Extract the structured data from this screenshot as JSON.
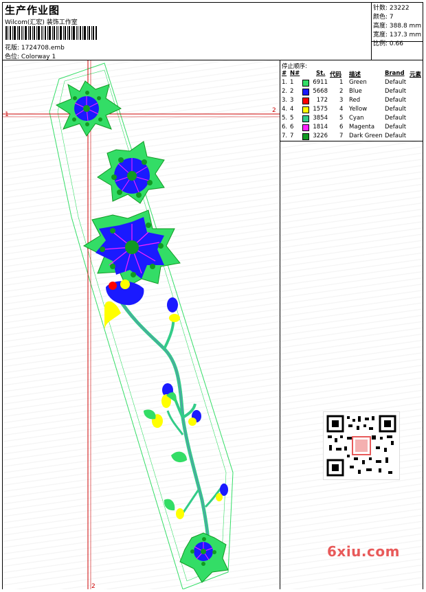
{
  "header": {
    "title": "生产作业图",
    "company": "Wilcom(汇宏) 装饰工作室",
    "design_label": "花版:",
    "design_value": "1724708.emb",
    "colorway_label": "色位:",
    "colorway_value": "Colorway 1"
  },
  "stats": {
    "stitches_label": "针数:",
    "stitches_value": "23222",
    "colors_label": "颜色:",
    "colors_value": "7",
    "height_label": "高度:",
    "height_value": "388.8 mm",
    "width_label": "宽度:",
    "width_value": "137.3 mm",
    "scale_label": "比例:",
    "scale_value": "0.66"
  },
  "canvas": {
    "marker_left": "1",
    "marker_right": "2",
    "marker_bottom": "2"
  },
  "legend": {
    "title": "停止顺序:",
    "headers": {
      "index": "#",
      "no": "N#",
      "stitches": "St.",
      "code": "代码",
      "desc": "描述",
      "brand": "Brand",
      "element": "元素"
    },
    "rows": [
      {
        "index": "1.",
        "no": "1",
        "stitches": "6911",
        "code": "1",
        "desc": "Green",
        "brand": "Default",
        "color": "#33dd66"
      },
      {
        "index": "2.",
        "no": "2",
        "stitches": "5668",
        "code": "2",
        "desc": "Blue",
        "brand": "Default",
        "color": "#1a1aff"
      },
      {
        "index": "3.",
        "no": "3",
        "stitches": "172",
        "code": "3",
        "desc": "Red",
        "brand": "Default",
        "color": "#ff0000"
      },
      {
        "index": "4.",
        "no": "4",
        "stitches": "1575",
        "code": "4",
        "desc": "Yellow",
        "brand": "Default",
        "color": "#ffff00"
      },
      {
        "index": "5.",
        "no": "5",
        "stitches": "3854",
        "code": "5",
        "desc": "Cyan",
        "brand": "Default",
        "color": "#33cc88"
      },
      {
        "index": "6.",
        "no": "6",
        "stitches": "1814",
        "code": "6",
        "desc": "Magenta",
        "brand": "Default",
        "color": "#ff22ff"
      },
      {
        "index": "7.",
        "no": "7",
        "stitches": "3226",
        "code": "7",
        "desc": "Dark Green",
        "brand": "Default",
        "color": "#119922"
      }
    ]
  },
  "watermark": {
    "site": "6xiu.com",
    "qr_icon": "qr-code-icon"
  }
}
